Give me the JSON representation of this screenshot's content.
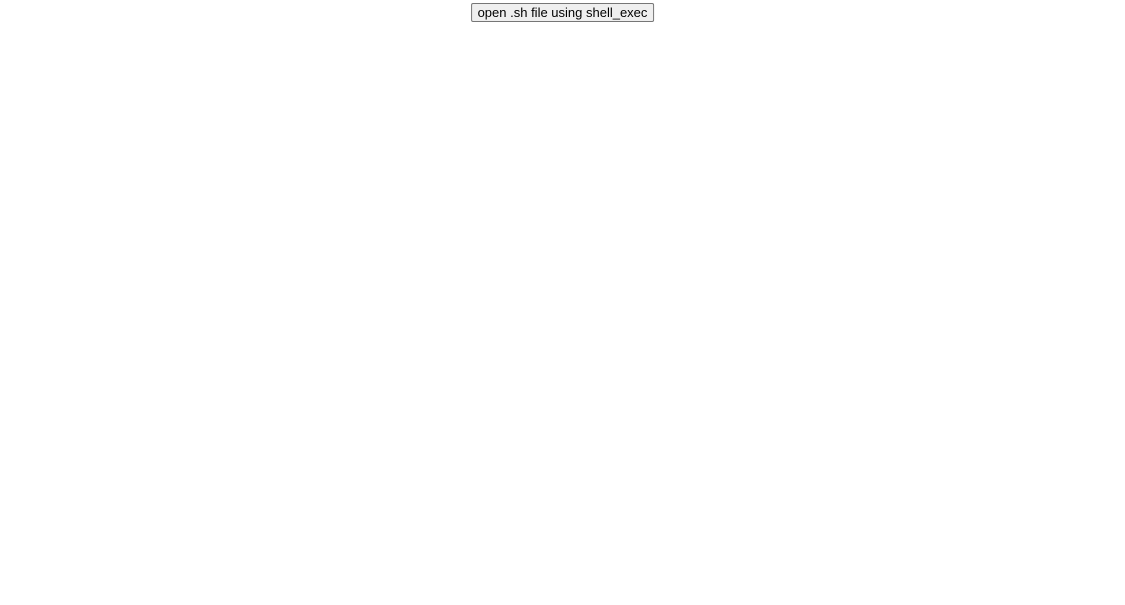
{
  "button": {
    "label": "open .sh file using shell_exec"
  }
}
